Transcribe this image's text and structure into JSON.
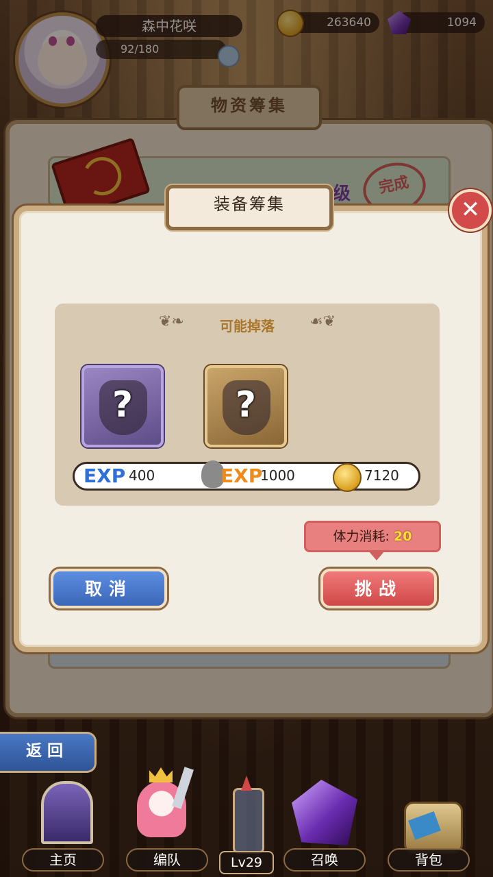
{
  "header": {
    "player_name": "森中花咲",
    "stamina": "92/180",
    "gold": "263640",
    "gems": "1094"
  },
  "background_panel": {
    "title": "物资筹集",
    "card_tier": "高级",
    "card_stamp": "完成"
  },
  "dialog": {
    "title": "装备筹集",
    "drop_title": "可能掉落",
    "items": [
      {
        "rarity": "purple",
        "mark": "?"
      },
      {
        "rarity": "gold",
        "mark": "?"
      }
    ],
    "rewards": {
      "exp_label": "EXP",
      "team_exp": "400",
      "player_exp": "1000",
      "gold": "7120"
    },
    "cost_label": "体力消耗:",
    "cost_value": "20",
    "cancel_label": "取消",
    "challenge_label": "挑战",
    "close_mark": "✕"
  },
  "nav": {
    "back_label": "返回",
    "items": [
      "主页",
      "编队",
      "召唤",
      "背包"
    ],
    "level": "Lv29"
  },
  "colors": {
    "exp_blue": "#2e6fd8",
    "exp_orange": "#f08a1a",
    "cancel_blue": "#3b66b8",
    "challenge_red": "#d04848"
  }
}
